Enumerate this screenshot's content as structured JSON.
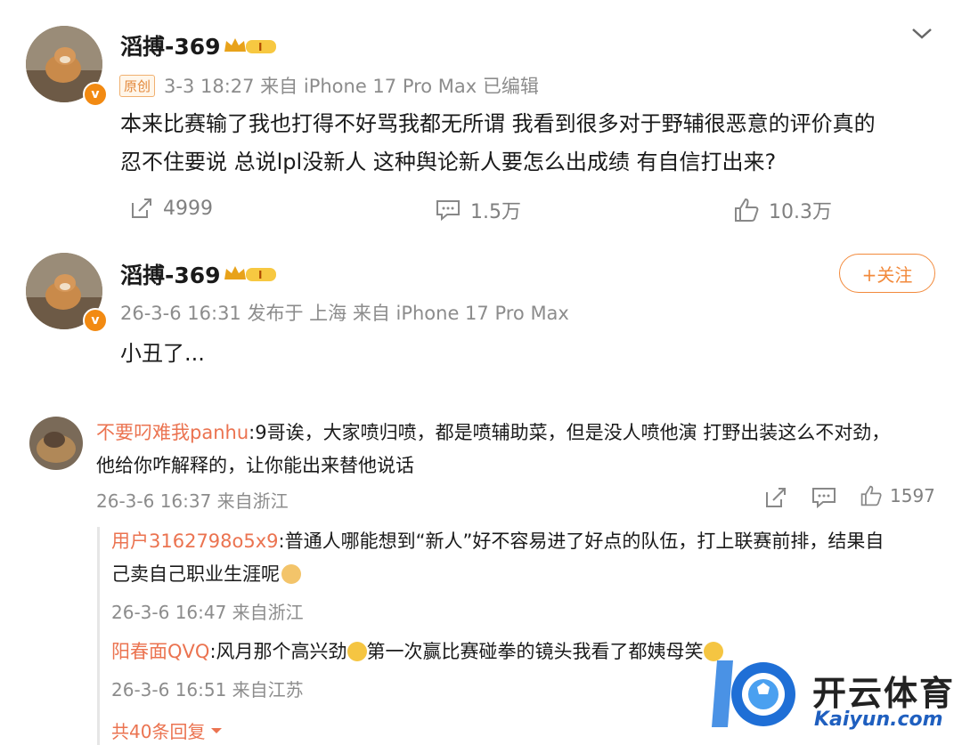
{
  "post": {
    "username": "滔搏-369",
    "level_badge": "I",
    "original_tag": "原创",
    "meta": "3-3 18:27 来自 iPhone 17 Pro Max 已编辑",
    "content_line1": "本来比赛输了我也打得不好骂我都无所谓  我看到很多对于野辅很恶意的评价真的",
    "content_line2": "忍不住要说 总说lpl没新人 这种舆论新人要怎么出成绩 有自信打出来?",
    "repost_count": "4999",
    "comment_count": "1.5万",
    "like_count": "10.3万"
  },
  "post2": {
    "username": "滔搏-369",
    "level_badge": "I",
    "meta": "26-3-6 16:31 发布于 上海 来自 iPhone 17 Pro Max",
    "content": "小丑了...",
    "follow_label": "+关注"
  },
  "comment": {
    "author": "不要叼难我panhu",
    "text_line1": ":9哥诶，大家喷归喷，都是喷辅助菜，但是没人喷他演 打野出装这么不对劲，",
    "text_line2": "他给你咋解释的，让你能出来替他说话",
    "meta": "26-3-6 16:37 来自浙江",
    "like_count": "1597"
  },
  "replies": [
    {
      "author": "用户3162798o5x9",
      "text_line1": ":普通人哪能想到“新人”好不容易进了好点的队伍，打上联赛前排，结果自",
      "text_line2": "己卖自己职业生涯呢",
      "meta": "26-3-6 16:47 来自浙江"
    },
    {
      "author": "阳春面QVQ",
      "text_line1": ":风月那个高兴劲",
      "text_mid": "第一次赢比赛碰拳的镜头我看了都姨母笑",
      "meta": "26-3-6 16:51 来自江苏"
    }
  ],
  "more_replies": "共40条回复",
  "watermark": {
    "title": "开云体育",
    "subtitle": "Kaiyun.com"
  },
  "colors": {
    "accent_orange": "#f28a3c",
    "name_orange": "#eb7350",
    "meta_gray": "#8c8c8c"
  }
}
